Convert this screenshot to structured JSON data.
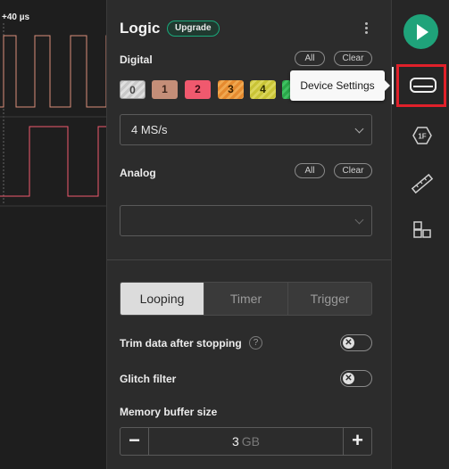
{
  "waveform": {
    "time_label": "+40 µs",
    "colors": {
      "channel_a": "#d98f7a",
      "channel_b": "#f0596e"
    }
  },
  "panel": {
    "title": "Logic",
    "upgrade_label": "Upgrade",
    "digital": {
      "label": "Digital",
      "all_label": "All",
      "clear_label": "Clear",
      "channels": [
        "0",
        "1",
        "2",
        "3",
        "4"
      ],
      "sample_rate": "4 MS/s"
    },
    "analog": {
      "label": "Analog",
      "all_label": "All",
      "clear_label": "Clear",
      "sample_rate": ""
    },
    "capture_modes": [
      "Looping",
      "Timer",
      "Trigger"
    ],
    "active_mode": "Looping",
    "trim_label": "Trim data after stopping",
    "help_glyph": "?",
    "glitch_label": "Glitch filter",
    "toggle_glyph": "✕",
    "memory": {
      "label": "Memory buffer size",
      "value": "3",
      "unit": "GB",
      "minus": "−",
      "plus": "+"
    }
  },
  "tooltip": {
    "text": "Device Settings"
  },
  "toolbar": {
    "items": [
      {
        "icon": "play-icon"
      },
      {
        "icon": "device-settings-icon",
        "selected": true
      },
      {
        "icon": "analyzers-icon",
        "label": "1F"
      },
      {
        "icon": "measure-ruler-icon"
      },
      {
        "icon": "extensions-icon"
      }
    ]
  },
  "theme": {
    "accent": "#1fa37a",
    "highlight": "#e0202a",
    "panel_bg": "#2c2c2c"
  }
}
